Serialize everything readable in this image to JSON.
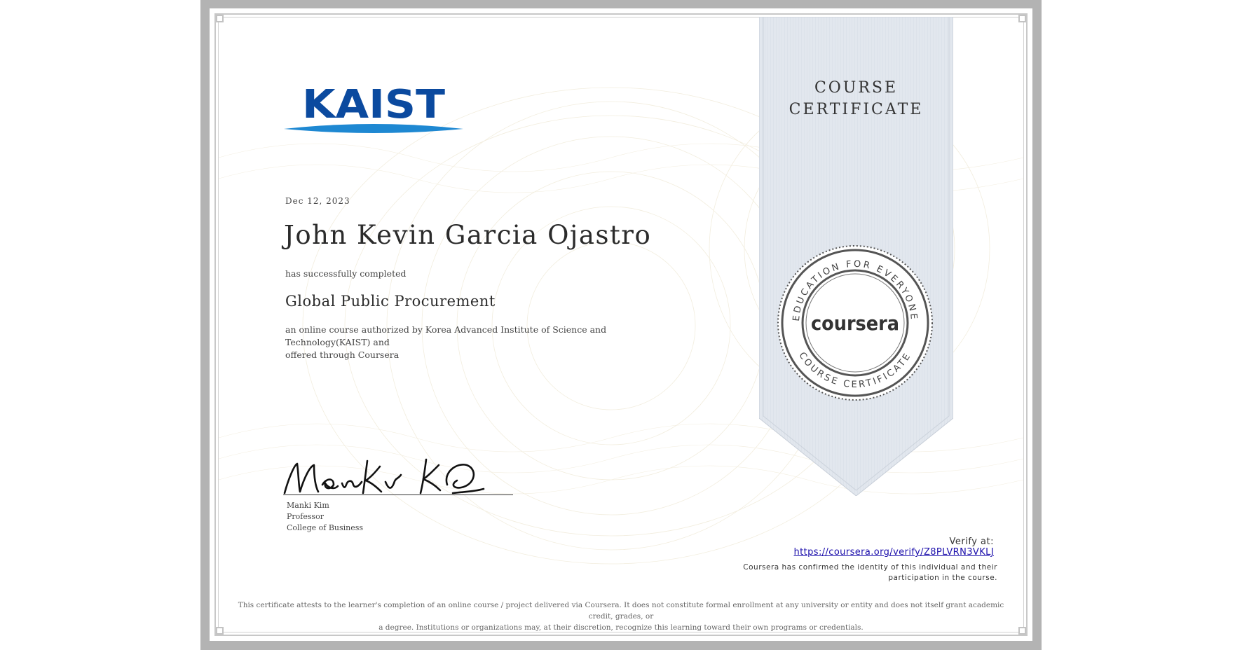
{
  "logo": {
    "text": "KAIST",
    "color": "#0b4a9f",
    "swoosh_color": "#1e88d2"
  },
  "ribbon": {
    "line1": "COURSE",
    "line2": "CERTIFICATE",
    "fill": "#e2e7ee"
  },
  "seal": {
    "top_text": "EDUCATION FOR EVERYONE",
    "center_text": "coursera",
    "bottom_text": "COURSE CERTIFICATE"
  },
  "certificate": {
    "date": "Dec 12, 2023",
    "recipient": "John Kevin Garcia Ojastro",
    "completed_text": "has successfully completed",
    "course_title": "Global Public Procurement",
    "authorized_line1": "an online course authorized by Korea Advanced Institute of Science and Technology(KAIST) and",
    "authorized_line2": "offered through Coursera"
  },
  "signer": {
    "signature_text": "Manki Kim",
    "name": "Manki Kim",
    "title": "Professor",
    "department": "College of Business"
  },
  "verify": {
    "label": "Verify at:",
    "url": "https://coursera.org/verify/Z8PLVRN3VKLJ",
    "confirmed_line1": "Coursera has confirmed the identity of this individual and their",
    "confirmed_line2": "participation in the course."
  },
  "disclaimer": {
    "line1": "This certificate attests to the learner's completion of an online course / project delivered via Coursera. It does not constitute formal enrollment at any university or entity and does not itself grant academic credit, grades, or",
    "line2": "a degree. Institutions or organizations may, at their discretion, recognize this learning toward their own programs or credentials."
  }
}
